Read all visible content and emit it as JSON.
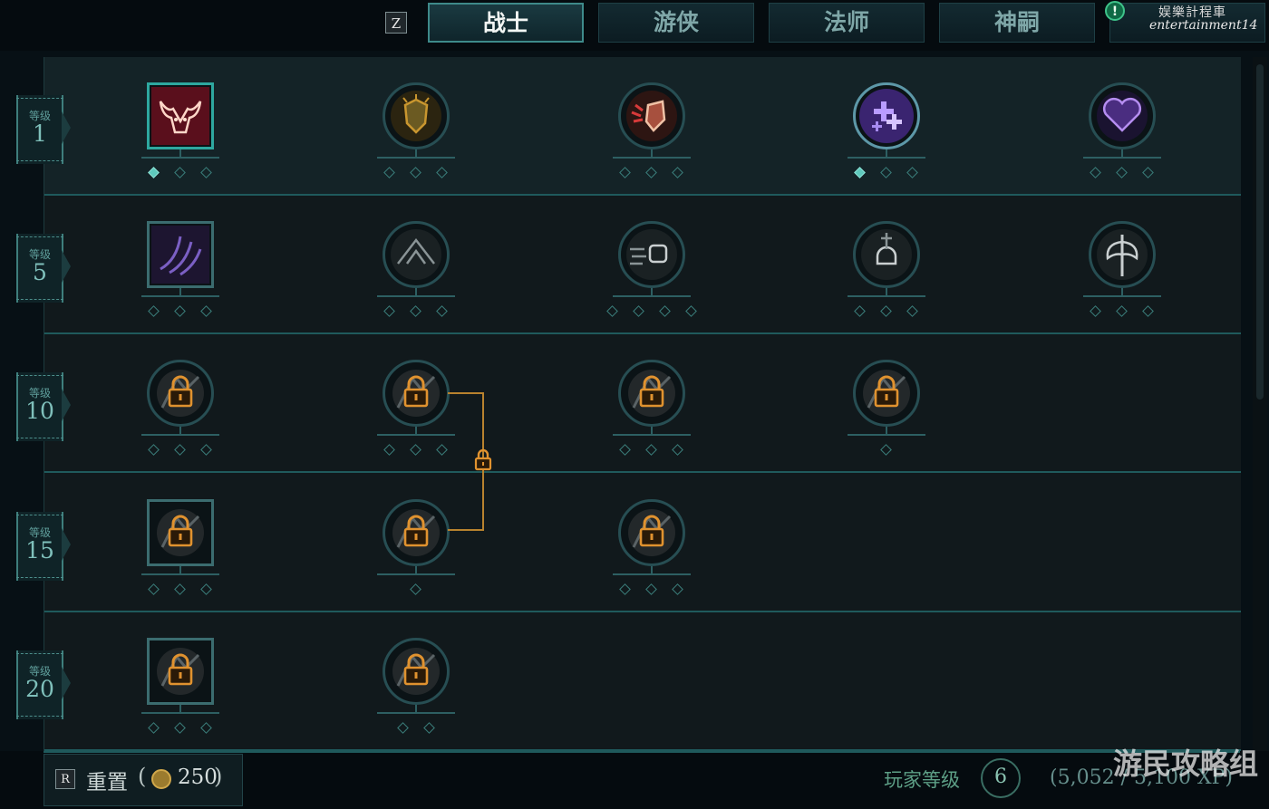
{
  "top": {
    "toggle_key": "Z",
    "tabs": [
      {
        "label": "战士",
        "active": true
      },
      {
        "label": "游侠",
        "active": false
      },
      {
        "label": "法师",
        "active": false
      },
      {
        "label": "神嗣",
        "active": false
      }
    ],
    "alert": "!",
    "watermark_line1": "娱樂計程車",
    "watermark_line2": "entertainment14"
  },
  "tree": {
    "level_caption": "等级",
    "rows": [
      {
        "level": "1",
        "nodes": [
          {
            "icon": "bull-head-icon",
            "shape": "square",
            "active": true,
            "locked": false,
            "pips": 3,
            "filled": 1
          },
          {
            "icon": "shield-burst-icon",
            "shape": "circle",
            "active": false,
            "locked": false,
            "pips": 3,
            "filled": 0
          },
          {
            "icon": "shield-strike-icon",
            "shape": "circle",
            "active": false,
            "locked": false,
            "pips": 3,
            "filled": 0
          },
          {
            "icon": "purple-crosses-icon",
            "shape": "circle",
            "active": true,
            "locked": false,
            "pips": 3,
            "filled": 1
          },
          {
            "icon": "purple-heart-icon",
            "shape": "circle",
            "active": false,
            "locked": false,
            "pips": 3,
            "filled": 0
          }
        ]
      },
      {
        "level": "5",
        "nodes": [
          {
            "icon": "purple-claw-icon",
            "shape": "square",
            "active": false,
            "locked": false,
            "pips": 3,
            "filled": 0
          },
          {
            "icon": "tent-icon",
            "shape": "circle",
            "active": false,
            "locked": false,
            "pips": 3,
            "filled": 0
          },
          {
            "icon": "fist-punch-icon",
            "shape": "circle",
            "active": false,
            "locked": false,
            "pips": 4,
            "filled": 0
          },
          {
            "icon": "skull-sword-icon",
            "shape": "circle",
            "active": false,
            "locked": false,
            "pips": 3,
            "filled": 0
          },
          {
            "icon": "double-axe-icon",
            "shape": "circle",
            "active": false,
            "locked": false,
            "pips": 3,
            "filled": 0
          }
        ]
      },
      {
        "level": "10",
        "nodes": [
          {
            "icon": "locked-burst-icon",
            "shape": "circle",
            "active": false,
            "locked": true,
            "pips": 3,
            "filled": 0
          },
          {
            "icon": "locked-shield-icon",
            "shape": "circle",
            "active": false,
            "locked": true,
            "pips": 3,
            "filled": 0
          },
          {
            "icon": "locked-swirl-icon",
            "shape": "circle",
            "active": false,
            "locked": true,
            "pips": 3,
            "filled": 0
          },
          {
            "icon": "locked-dash-icon",
            "shape": "circle",
            "active": false,
            "locked": true,
            "pips": 1,
            "filled": 0
          }
        ]
      },
      {
        "level": "15",
        "nodes": [
          {
            "icon": "locked-arrows-icon",
            "shape": "square",
            "active": false,
            "locked": true,
            "pips": 3,
            "filled": 0
          },
          {
            "icon": "locked-slash-icon",
            "shape": "circle",
            "active": false,
            "locked": true,
            "pips": 1,
            "filled": 0
          },
          {
            "icon": "locked-whirl-icon",
            "shape": "circle",
            "active": false,
            "locked": true,
            "pips": 3,
            "filled": 0
          }
        ]
      },
      {
        "level": "20",
        "nodes": [
          {
            "icon": "locked-spin-icon",
            "shape": "square",
            "active": false,
            "locked": true,
            "pips": 3,
            "filled": 0
          },
          {
            "icon": "locked-totem-icon",
            "shape": "circle",
            "active": false,
            "locked": true,
            "pips": 2,
            "filled": 0
          }
        ]
      }
    ]
  },
  "bottom": {
    "reset_key": "R",
    "reset_label": "重置",
    "reset_open": "(",
    "reset_cost": "250",
    "reset_close": ")",
    "player_level_label": "玩家等级",
    "player_level": "6",
    "xp_text": "(5,052 / 5,100 XP)",
    "watermark": "游民攻略组"
  },
  "colors": {
    "accent": "#2ea8a0",
    "locked": "#d08a2e",
    "filled_pip": "#5fc9bd"
  }
}
